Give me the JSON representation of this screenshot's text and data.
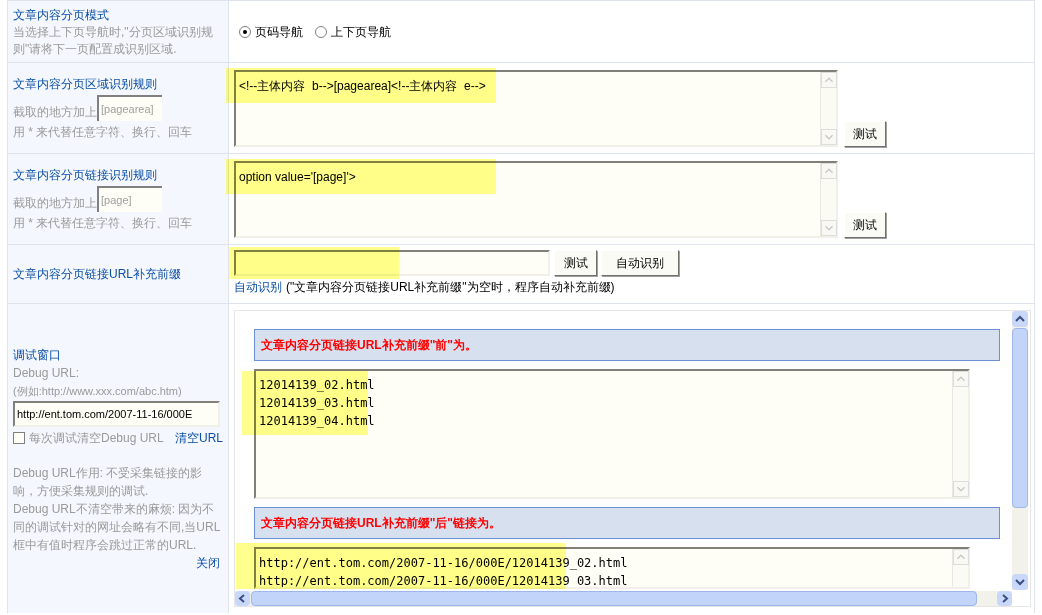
{
  "rows": [
    {
      "kind": "radio",
      "label": "文章内容分页模式",
      "hint": "当选择上下页导航时,\"分页区域识别规则\"请将下一页配置成识别区域.",
      "options": [
        {
          "label": "页码导航",
          "selected": true
        },
        {
          "label": "上下页导航",
          "selected": false
        }
      ]
    },
    {
      "kind": "textarea",
      "label": "文章内容分页区域识别规则",
      "hint_prefix": "截取的地方加上",
      "tag_placeholder": "[pagearea]",
      "hint_suffix": "用 * 来代替任意字符、换行、回车",
      "value": "<!--主体内容  b-->[pagearea]<!--主体内容  e-->",
      "button": "测试"
    },
    {
      "kind": "textarea",
      "label": "文章内容分页链接识别规则",
      "hint_prefix": "截取的地方加上",
      "tag_placeholder": "[page]",
      "hint_suffix": "用 * 来代替任意字符、换行、回车",
      "value": "option value='[page]'>",
      "button": "测试"
    },
    {
      "kind": "prefix",
      "label": "文章内容分页链接URL补充前缀",
      "buttons": [
        "测试",
        "自动识别"
      ],
      "link": "自动识别",
      "note": "(\"文章内容分页链接URL补充前缀\"为空时，程序自动补充前缀)"
    }
  ],
  "debug": {
    "title": "调试窗口",
    "url_label": "Debug URL:",
    "example": "(例如:http://www.xxx.com/abc.htm)",
    "url": "http://ent.tom.com/2007-11-16/000E",
    "clear_each": {
      "label": "每次调试清空Debug URL",
      "checked": false
    },
    "clear_link": "清空URL",
    "notes": [
      "Debug URL作用: 不受采集链接的影响，方便采集规则的调试.",
      "Debug URL不清空带来的麻烦: 因为不同的调试针对的网址会略有不同,当URL框中有值时程序会跳过正常的URL."
    ],
    "close": "关闭",
    "results": [
      {
        "heading": "文章内容分页链接URL补充前缀\"前\"为。",
        "lines": [
          "12014139_02.html",
          "12014139_03.html",
          "12014139_04.html"
        ]
      },
      {
        "heading": "文章内容分页链接URL补充前缀\"后\"链接为。",
        "lines": [
          "http://ent.tom.com/2007-11-16/000E/12014139_02.html",
          "http://ent.tom.com/2007-11-16/000E/12014139_03.html"
        ]
      }
    ]
  }
}
